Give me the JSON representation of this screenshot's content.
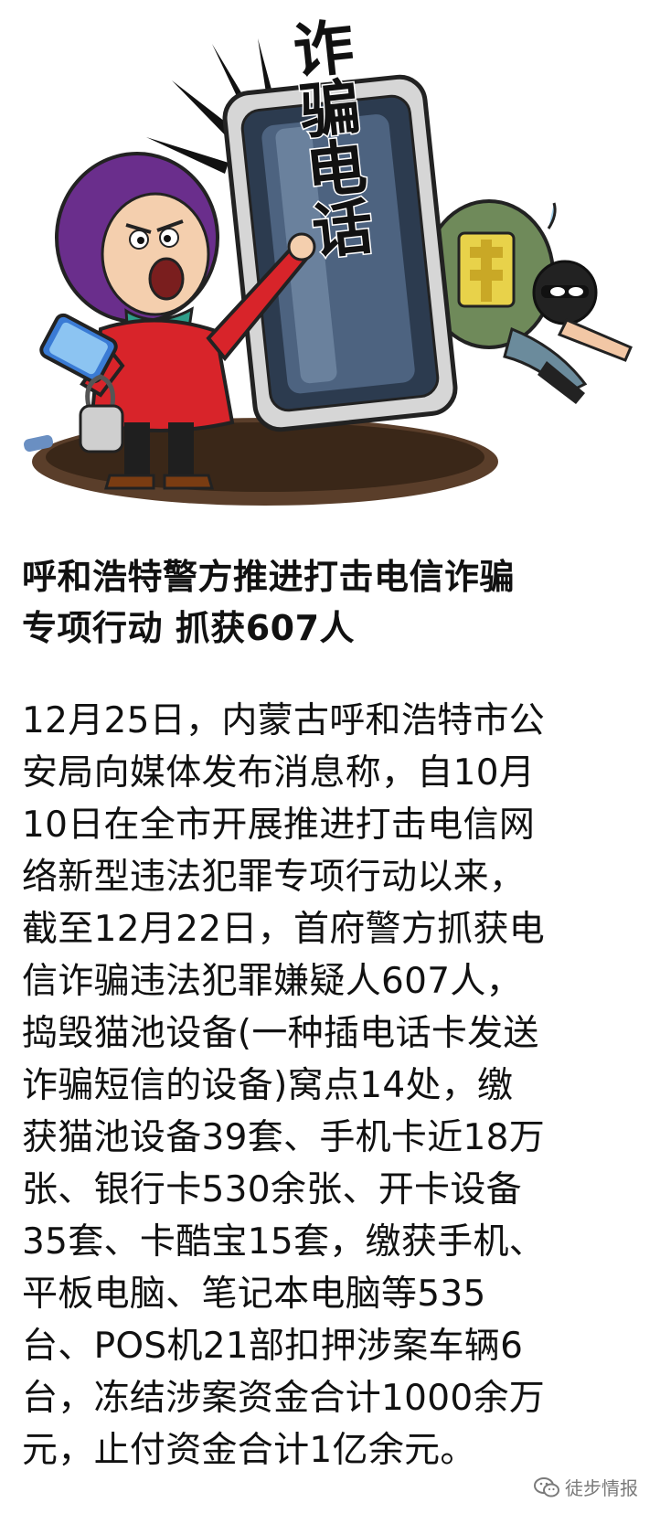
{
  "illustration": {
    "sign_text": "诈骗电话"
  },
  "headline": {
    "line1": "呼和浩特警方推进打击电信诈骗",
    "line2": "专项行动 抓获607人"
  },
  "body_lines": [
    "12月25日，内蒙古呼和浩特市公",
    "安局向媒体发布消息称，自10月",
    "10日在全市开展推进打击电信网",
    "络新型违法犯罪专项行动以来，",
    "截至12月22日，首府警方抓获电",
    "信诈骗违法犯罪嫌疑人607人，",
    "捣毁猫池设备(一种插电话卡发送",
    "诈骗短信的设备)窝点14处，缴",
    "获猫池设备39套、手机卡近18万",
    "张、银行卡530余张、开卡设备",
    "35套、卡酷宝15套，缴获手机、",
    "平板电脑、笔记本电脑等535",
    "台、POS机21部扣押涉案车辆6",
    "台，冻结涉案资金合计1000余万",
    "元，止付资金合计1亿余元。"
  ],
  "watermark": {
    "text": "徒步情报",
    "icon": "wechat-icon"
  },
  "colors": {
    "background": "#ffffff",
    "text": "#111111",
    "watermark": "#7a7a7a"
  }
}
